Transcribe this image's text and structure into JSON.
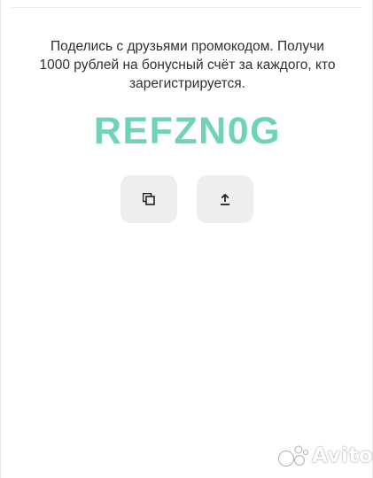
{
  "referral": {
    "description_lines": [
      "Поделись с друзьями промокодом. Получи",
      "1000 рублей на бонусный счёт за каждого, кто",
      "зарегистрируется."
    ],
    "promo_code": "REFZN0G"
  },
  "actions": {
    "copy_icon": "copy-icon",
    "share_icon": "share-upload-icon"
  },
  "watermark": {
    "text": "Avito"
  },
  "colors": {
    "accent": "#6fd3bb",
    "button_bg": "#eeeeee",
    "text": "#2f2f2f"
  }
}
